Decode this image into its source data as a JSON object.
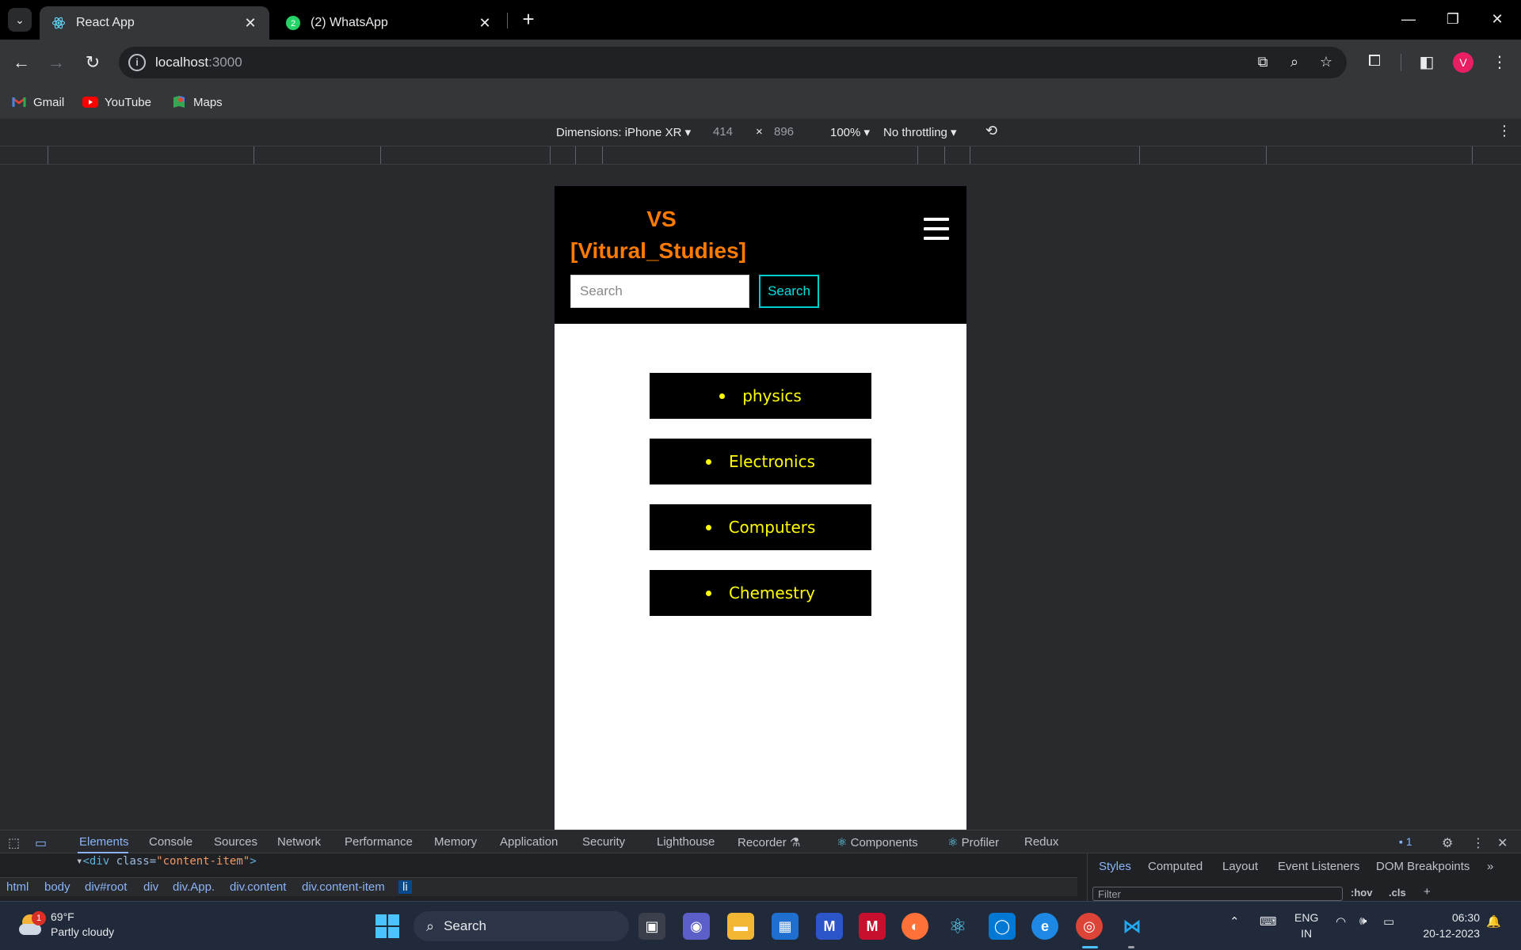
{
  "browser": {
    "tabs": [
      {
        "title": "React App",
        "active": true
      },
      {
        "title": "(2) WhatsApp",
        "active": false
      }
    ],
    "whatsapp_badge": "2",
    "url_host": "localhost",
    "url_port": ":3000",
    "profile_initial": "V",
    "bookmarks": [
      {
        "label": "Gmail",
        "icon": "gmail-icon"
      },
      {
        "label": "YouTube",
        "icon": "youtube-icon"
      },
      {
        "label": "Maps",
        "icon": "maps-icon"
      }
    ]
  },
  "device_toolbar": {
    "dimensions_label": "Dimensions: iPhone XR",
    "width": "414",
    "times": "×",
    "height": "896",
    "zoom": "100%",
    "throttling": "No throttling"
  },
  "app": {
    "logo_line1": "VS",
    "logo_line2": "[Vitural_Studies]",
    "search_placeholder": "Search",
    "search_button": "Search",
    "items": [
      "physics",
      "Electronics",
      "Computers",
      "Chemestry"
    ]
  },
  "devtools": {
    "tabs": [
      "Elements",
      "Console",
      "Sources",
      "Network",
      "Performance",
      "Memory",
      "Application",
      "Security",
      "Lighthouse",
      "Recorder",
      "Components",
      "Profiler",
      "Redux"
    ],
    "issues_count": "1",
    "dom_line_tag_open": "<div ",
    "dom_line_attr": "class=",
    "dom_line_val": "\"content-item\"",
    "dom_line_close": ">",
    "breadcrumbs": [
      "html",
      "body",
      "div#root",
      "div",
      "div.App.",
      "div.content",
      "div.content-item",
      "li"
    ],
    "style_tabs": [
      "Styles",
      "Computed",
      "Layout",
      "Event Listeners",
      "DOM Breakpoints"
    ],
    "filter_placeholder": "Filter",
    "hov": ":hov",
    "cls": ".cls"
  },
  "taskbar": {
    "weather_temp": "69°F",
    "weather_desc": "Partly cloudy",
    "weather_badge": "1",
    "search_label": "Search",
    "lang_line1": "ENG",
    "lang_line2": "IN",
    "time": "06:30",
    "date": "20-12-2023"
  },
  "colors": {
    "logo": "#ff7b00",
    "item_text": "#ffff00",
    "search_button_border": "#00d0d0",
    "devtools_accent": "#8ab4f8"
  }
}
